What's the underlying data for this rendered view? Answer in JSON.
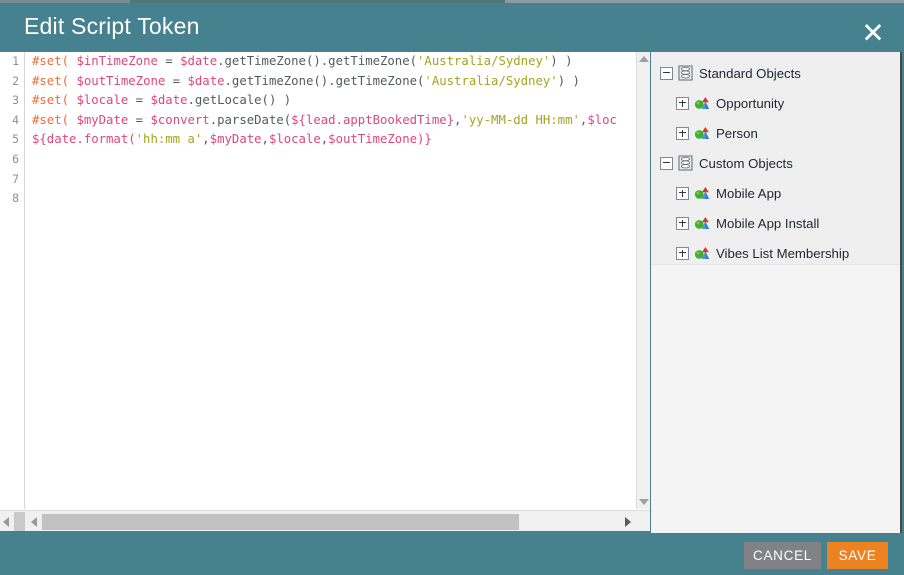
{
  "dialog": {
    "title": "Edit Script Token",
    "close_icon": "close-x-icon"
  },
  "editor": {
    "line_numbers": [
      "1",
      "2",
      "3",
      "4",
      "5",
      "6",
      "7",
      "8"
    ],
    "lines": [
      {
        "number": "1",
        "text": "#set( $inTimeZone = $date.getTimeZone().getTimeZone('Australia/Sydney') )",
        "tokens": [
          {
            "t": "#set(",
            "c": "dir"
          },
          {
            "t": " ",
            "c": "plain"
          },
          {
            "t": "$inTimeZone",
            "c": "var"
          },
          {
            "t": " = ",
            "c": "plain"
          },
          {
            "t": "$date",
            "c": "var"
          },
          {
            "t": ".getTimeZone().getTimeZone(",
            "c": "plain"
          },
          {
            "t": "'Australia/Sydney'",
            "c": "str"
          },
          {
            "t": ") )",
            "c": "plain"
          }
        ]
      },
      {
        "number": "2",
        "text": "#set( $outTimeZone = $date.getTimeZone().getTimeZone('Australia/Sydney') )",
        "tokens": [
          {
            "t": "#set(",
            "c": "dir"
          },
          {
            "t": " ",
            "c": "plain"
          },
          {
            "t": "$outTimeZone",
            "c": "var"
          },
          {
            "t": " = ",
            "c": "plain"
          },
          {
            "t": "$date",
            "c": "var"
          },
          {
            "t": ".getTimeZone().getTimeZone(",
            "c": "plain"
          },
          {
            "t": "'Australia/Sydney'",
            "c": "str"
          },
          {
            "t": ") )",
            "c": "plain"
          }
        ]
      },
      {
        "number": "3",
        "text": "#set( $locale = $date.getLocale() )",
        "tokens": [
          {
            "t": "#set(",
            "c": "dir"
          },
          {
            "t": " ",
            "c": "plain"
          },
          {
            "t": "$locale",
            "c": "var"
          },
          {
            "t": " = ",
            "c": "plain"
          },
          {
            "t": "$date",
            "c": "var"
          },
          {
            "t": ".getLocale() )",
            "c": "plain"
          }
        ]
      },
      {
        "number": "4",
        "text": "#set( $myDate = $convert.parseDate(${lead.apptBookedTime},'yy-MM-dd HH:mm',$loc",
        "tokens": [
          {
            "t": "#set(",
            "c": "dir"
          },
          {
            "t": " ",
            "c": "plain"
          },
          {
            "t": "$myDate",
            "c": "var"
          },
          {
            "t": " = ",
            "c": "plain"
          },
          {
            "t": "$convert",
            "c": "var"
          },
          {
            "t": ".parseDate(",
            "c": "plain"
          },
          {
            "t": "${lead.apptBookedTime}",
            "c": "var"
          },
          {
            "t": ",",
            "c": "plain"
          },
          {
            "t": "'yy-MM-dd HH:mm'",
            "c": "str"
          },
          {
            "t": ",",
            "c": "plain"
          },
          {
            "t": "$loc",
            "c": "var"
          }
        ]
      },
      {
        "number": "5",
        "text": "${date.format('hh:mm a',$myDate,$locale,$outTimeZone)}",
        "tokens": [
          {
            "t": "${date.format(",
            "c": "var"
          },
          {
            "t": "'hh:mm a'",
            "c": "str"
          },
          {
            "t": ",",
            "c": "plain"
          },
          {
            "t": "$myDate",
            "c": "var"
          },
          {
            "t": ",",
            "c": "plain"
          },
          {
            "t": "$locale",
            "c": "var"
          },
          {
            "t": ",",
            "c": "plain"
          },
          {
            "t": "$outTimeZone",
            "c": "var"
          },
          {
            "t": ")}",
            "c": "var"
          }
        ]
      },
      {
        "number": "6",
        "text": "",
        "tokens": []
      },
      {
        "number": "7",
        "text": "",
        "tokens": []
      },
      {
        "number": "8",
        "text": "",
        "tokens": []
      }
    ],
    "v_scrollbar": {
      "up_arrow": "scroll-up-arrow-icon",
      "down_arrow": "scroll-down-arrow-icon"
    },
    "h_scrollbar": {
      "left_arrow": "scroll-left-arrow-icon",
      "right_arrow": "scroll-right-arrow-icon"
    }
  },
  "tree": {
    "items": [
      {
        "label": "Standard Objects",
        "level": 0,
        "expander": "minus",
        "icon": "database-icon"
      },
      {
        "label": "Opportunity",
        "level": 1,
        "expander": "plus",
        "icon": "object-icon"
      },
      {
        "label": "Person",
        "level": 1,
        "expander": "plus",
        "icon": "object-icon"
      },
      {
        "label": "Custom Objects",
        "level": 0,
        "expander": "minus",
        "icon": "database-icon"
      },
      {
        "label": "Mobile App",
        "level": 1,
        "expander": "plus",
        "icon": "object-icon"
      },
      {
        "label": "Mobile App Install",
        "level": 1,
        "expander": "plus",
        "icon": "object-icon"
      },
      {
        "label": "Vibes List Membership",
        "level": 1,
        "expander": "plus",
        "icon": "object-icon"
      }
    ]
  },
  "footer": {
    "cancel_label": "CANCEL",
    "save_label": "SAVE"
  },
  "colors": {
    "header_teal": "#45818f",
    "save_orange": "#ed8222",
    "cancel_gray": "#808285",
    "code_directive": "#e8703a",
    "code_variable": "#e0467c",
    "code_string": "#a3a522",
    "code_plain": "#555a5f"
  }
}
